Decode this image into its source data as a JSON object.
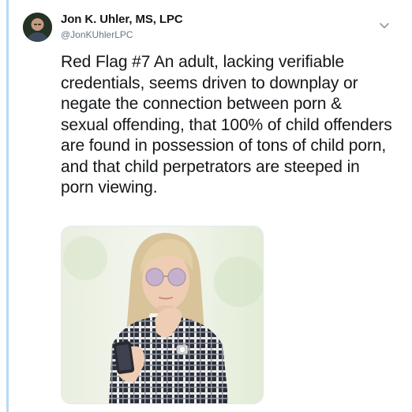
{
  "tweet": {
    "author_name": "Jon K. Uhler, MS, LPC",
    "author_handle": "@JonKUhlerLPC",
    "text": "Red Flag #7 An adult, lacking verifiable credentials, seems driven to downplay or negate the connection between porn & sexual offending, that 100% of child offenders are found in possession of tons of child porn, and that child perpetrators are steeped in porn viewing."
  },
  "icons": {
    "menu": "chevron-down-icon"
  },
  "colors": {
    "thread_line": "#b9dbf3",
    "text": "#14171a",
    "secondary_text": "#657786"
  }
}
